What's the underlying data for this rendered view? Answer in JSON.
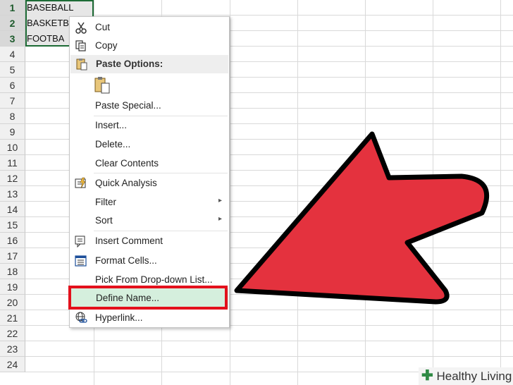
{
  "rows": [
    "1",
    "2",
    "3",
    "4",
    "5",
    "6",
    "7",
    "8",
    "9",
    "10",
    "11",
    "12",
    "13",
    "14",
    "15",
    "16",
    "17",
    "18",
    "19",
    "20",
    "21",
    "22",
    "23",
    "24"
  ],
  "cells": [
    "BASEBALL",
    "BASKETB",
    "FOOTBA"
  ],
  "menu": {
    "cut": "Cut",
    "copy": "Copy",
    "paste_options": "Paste Options:",
    "paste_special": "Paste Special...",
    "insert": "Insert...",
    "delete": "Delete...",
    "clear_contents": "Clear Contents",
    "quick_analysis": "Quick Analysis",
    "filter": "Filter",
    "sort": "Sort",
    "insert_comment": "Insert Comment",
    "format_cells": "Format Cells...",
    "pick_from_list": "Pick From Drop-down List...",
    "define_name": "Define Name...",
    "hyperlink": "Hyperlink..."
  },
  "submenu_arrow": "▸",
  "watermark": {
    "plus": "✚",
    "brand": "Healthy Living"
  },
  "colors": {
    "highlight": "#e3101c",
    "arrow": "#e4323e",
    "brand_green": "#2f8a45",
    "menu_hover": "#d5efdd"
  },
  "icons": [
    "scissors-icon",
    "copy-icon",
    "clipboard-icon",
    "quick-analysis-icon",
    "comment-icon",
    "format-cells-icon",
    "hyperlink-icon"
  ]
}
